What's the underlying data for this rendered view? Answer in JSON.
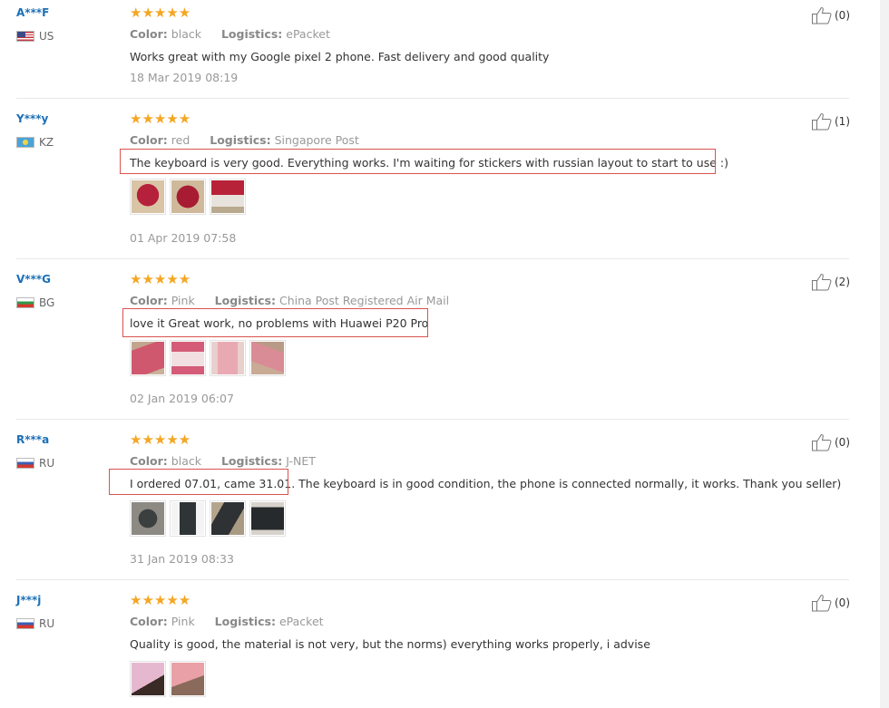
{
  "labels": {
    "color": "Color:",
    "logistics": "Logistics:"
  },
  "icons": {
    "star": "★",
    "like": "thumbs-up-icon"
  },
  "colors": {
    "star": "#f5a623",
    "username": "#1a6fb8",
    "highlight": "#d9534f"
  },
  "reviews": [
    {
      "user": "A***F",
      "country": "US",
      "stars": "★★★★★",
      "color": "black",
      "logistics": "ePacket",
      "text": "Works great with my Google pixel 2 phone. Fast delivery and good quality",
      "date": "18 Mar 2019 08:19",
      "likes": "(0)"
    },
    {
      "user": "Y***y",
      "country": "KZ",
      "stars": "★★★★★",
      "color": "red",
      "logistics": "Singapore Post",
      "text": "The keyboard is very good. Everything works. I'm waiting for stickers with russian layout to start to use :)",
      "date": "01 Apr 2019 07:58",
      "likes": "(1)"
    },
    {
      "user": "V***G",
      "country": "BG",
      "stars": "★★★★★",
      "color": "Pink",
      "logistics": "China Post Registered Air Mail",
      "text": "love it Great work, no problems with Huawei P20 Pro",
      "date": "02 Jan 2019 06:07",
      "likes": "(2)"
    },
    {
      "user": "R***a",
      "country": "RU",
      "stars": "★★★★★",
      "color": "black",
      "logistics": "J-NET",
      "text": "I ordered 07.01, came 31.01. The keyboard is in good condition, the phone is connected normally, it works. Thank you seller)",
      "date": "31 Jan 2019 08:33",
      "likes": "(0)"
    },
    {
      "user": "J***j",
      "country": "RU",
      "stars": "★★★★★",
      "color": "Pink",
      "logistics": "ePacket",
      "text": "Quality is good, the material is not very, but the norms) everything works properly, i advise",
      "likes": "(0)"
    }
  ]
}
